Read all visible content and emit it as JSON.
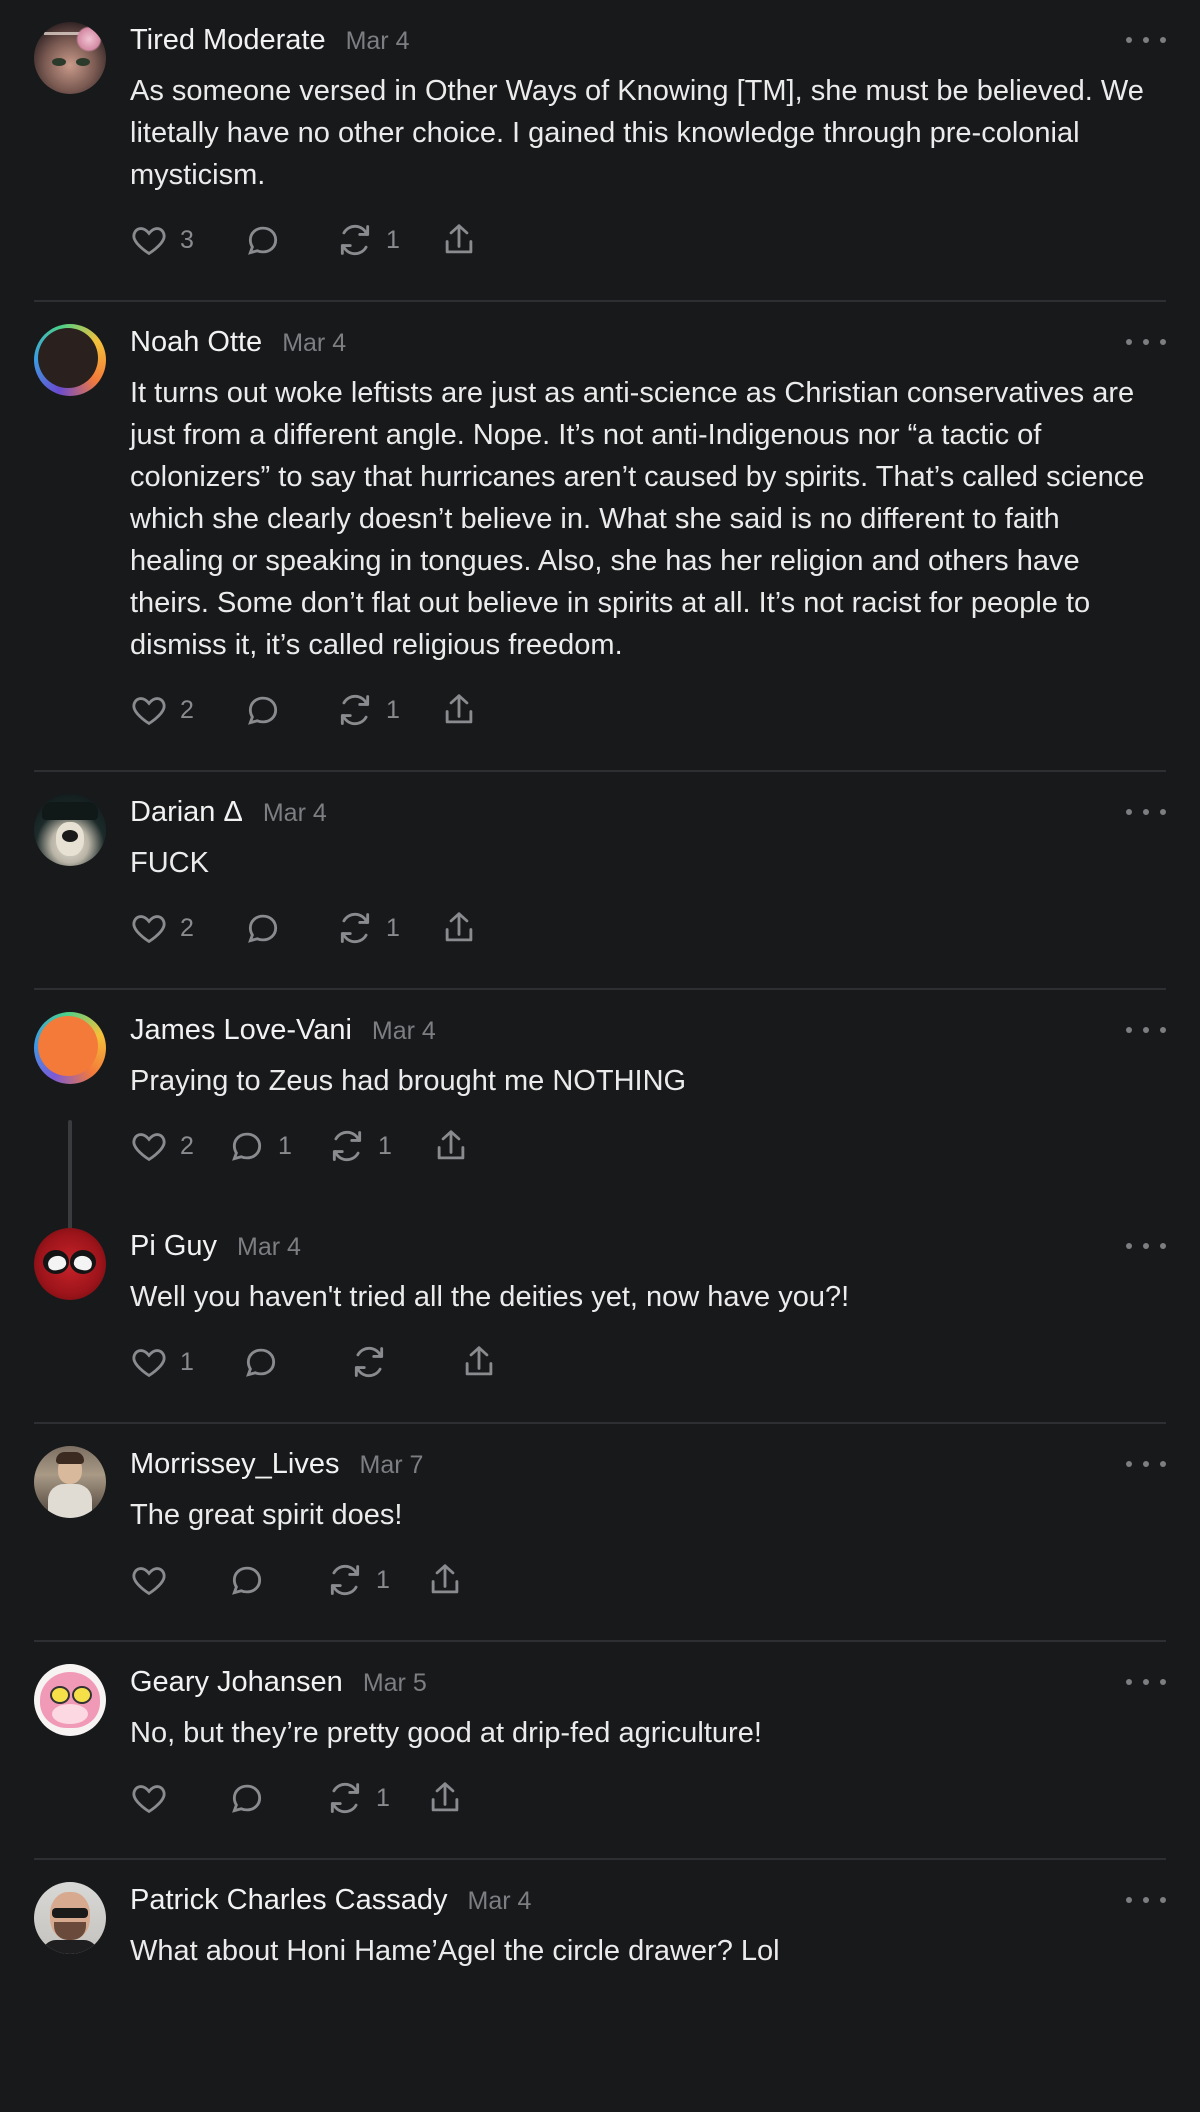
{
  "more_icon": "more-horizontal-icon",
  "action_icons": [
    "heart-icon",
    "comment-icon",
    "repost-icon",
    "share-icon"
  ],
  "colors": {
    "background": "#18191b",
    "text": "#ebebeb",
    "muted": "#7d7e82",
    "divider": "#2e2f32"
  },
  "comments": [
    {
      "author": "Tired Moderate",
      "date": "Mar 4",
      "text": "As someone versed in Other Ways of Knowing [TM], she must be believed. We litetally have no other choice. I gained this knowledge through pre-colonial mysticism.",
      "likes": "3",
      "replies": "",
      "reposts": "1"
    },
    {
      "author": "Noah Otte",
      "date": "Mar 4",
      "text": "It turns out woke leftists are just as anti-science as Christian conservatives are just from a different angle. Nope. It’s not anti-Indigenous nor “a tactic of colonizers” to say that hurricanes aren’t caused by spirits. That’s called science which she clearly doesn’t believe in. What she said is no different to faith healing or speaking in tongues. Also, she has her religion and others have theirs. Some don’t flat out believe in spirits at all. It’s not racist for people to dismiss it, it’s called religious freedom.",
      "likes": "2",
      "replies": "",
      "reposts": "1"
    },
    {
      "author": "Darian Δ",
      "date": "Mar 4",
      "text": "FUCK",
      "likes": "2",
      "replies": "",
      "reposts": "1"
    },
    {
      "author": "James Love-Vani",
      "date": "Mar 4",
      "text": "Praying to Zeus had brought me NOTHING",
      "likes": "2",
      "replies": "1",
      "reposts": "1"
    },
    {
      "author": "Pi Guy",
      "date": "Mar 4",
      "text": "Well you haven't tried all the deities yet, now have you?!",
      "likes": "1",
      "replies": "",
      "reposts": ""
    },
    {
      "author": "Morrissey_Lives",
      "date": "Mar 7",
      "text": "The great spirit does!",
      "likes": "",
      "replies": "",
      "reposts": "1"
    },
    {
      "author": "Geary Johansen",
      "date": "Mar 5",
      "text": "No, but they’re pretty good at drip-fed agriculture!",
      "likes": "",
      "replies": "",
      "reposts": "1"
    },
    {
      "author": "Patrick Charles Cassady",
      "date": "Mar 4",
      "text": "What about Honi Hame’Agel the circle drawer? Lol",
      "likes": "",
      "replies": "",
      "reposts": ""
    }
  ]
}
